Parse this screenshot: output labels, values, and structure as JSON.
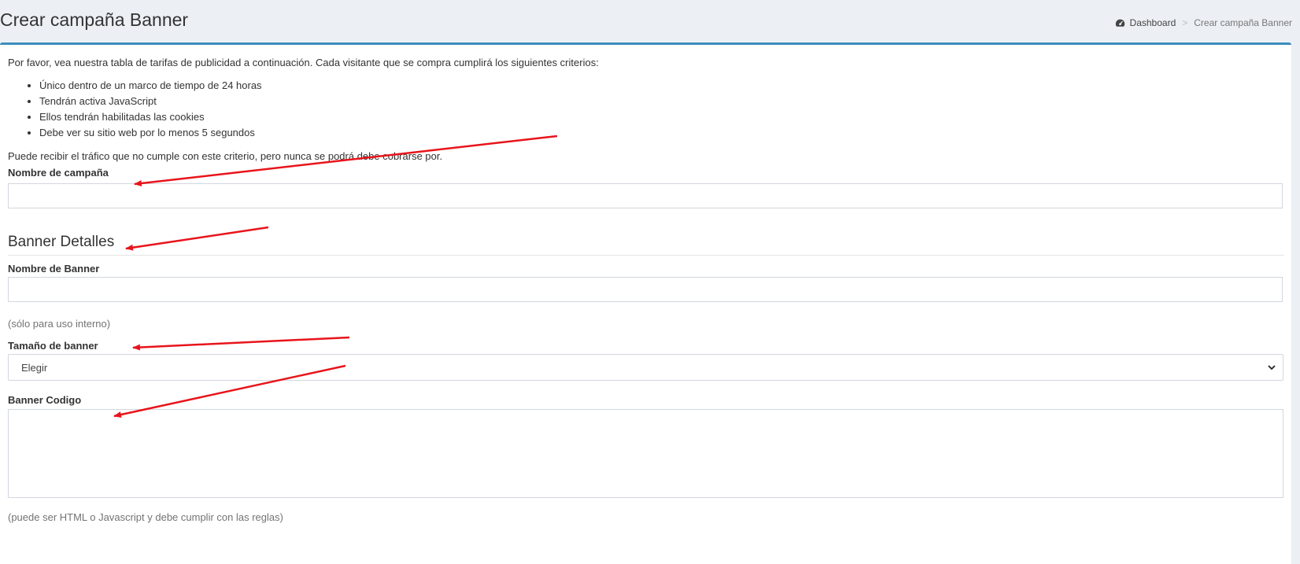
{
  "header": {
    "title": "Crear campaña Banner",
    "breadcrumb": {
      "home": "Dashboard",
      "separator": ">",
      "current": "Crear campaña Banner"
    }
  },
  "intro": "Por favor, vea nuestra tabla de tarifas de publicidad a continuación. Cada visitante que se compra cumplirá los siguientes criterios:",
  "criteria": [
    "Único dentro de un marco de tiempo de 24 horas",
    "Tendrán activa JavaScript",
    "Ellos tendrán habilitadas las cookies",
    "Debe ver su sitio web por lo menos 5 segundos"
  ],
  "disclaimer": "Puede recibir el tráfico que no cumple con este criterio, pero nunca se podrá debe cobrarse por.",
  "form": {
    "campaign_name_label": "Nombre de campaña",
    "campaign_name_value": "",
    "section_title": "Banner Detalles",
    "banner_name_label": "Nombre de Banner",
    "banner_name_value": "",
    "banner_name_help": "(sólo para uso interno)",
    "banner_size_label": "Tamaño de banner",
    "banner_size_selected": "Elegir",
    "banner_code_label": "Banner Codigo",
    "banner_code_value": "",
    "banner_code_help": "(puede ser HTML o Javascript y debe cumplir con las reglas)"
  },
  "colors": {
    "accent": "#3c8dbc",
    "annotation_arrow": "#e8141b",
    "page_bg": "#ecf0f5"
  },
  "icons": {
    "breadcrumb_home": "dashboard-icon",
    "select_toggle": "chevron-down-icon"
  }
}
